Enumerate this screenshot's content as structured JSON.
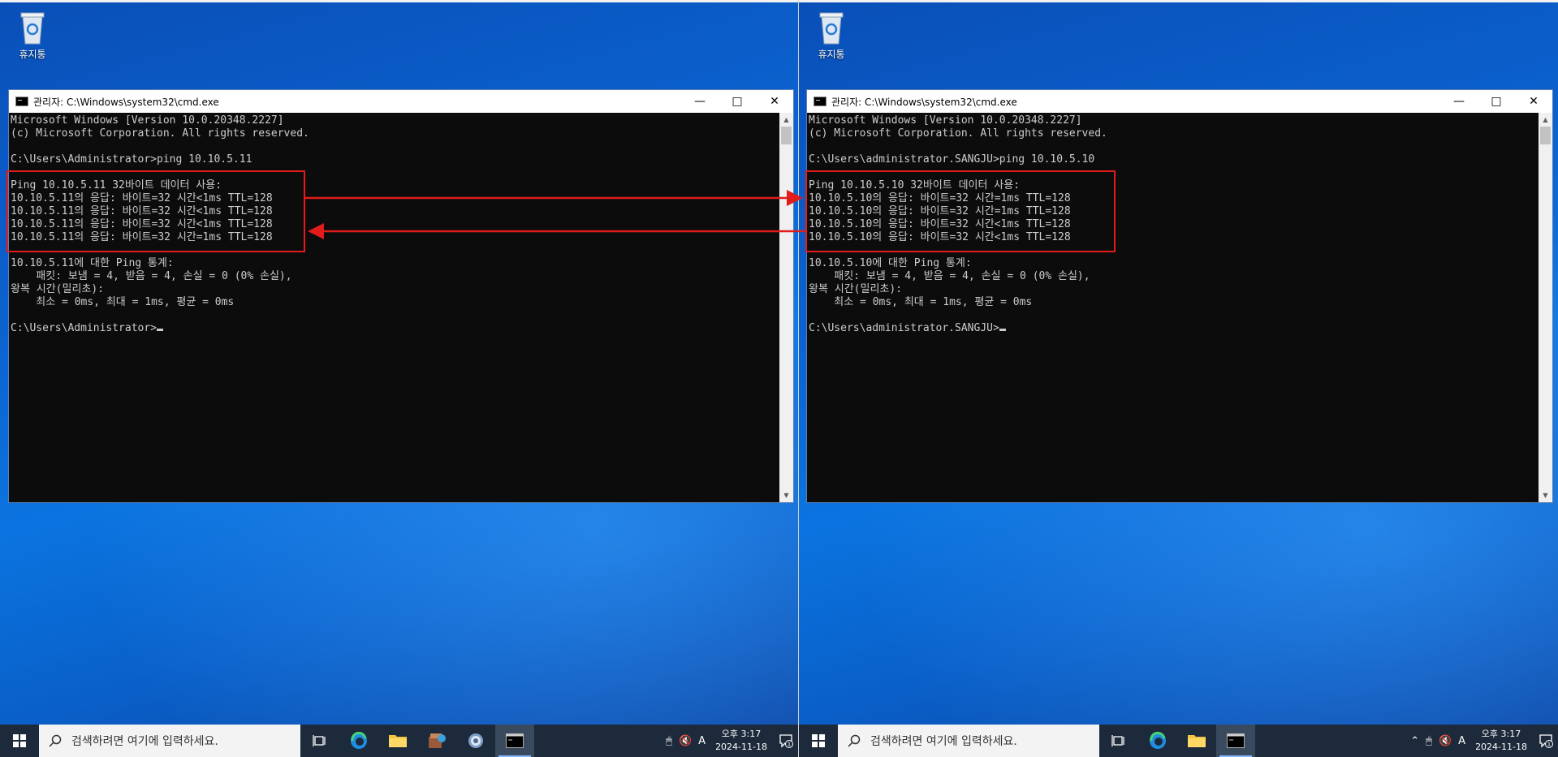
{
  "desktop": {
    "recycle_label": "휴지통"
  },
  "left": {
    "window_title": "관리자: C:\\Windows\\system32\\cmd.exe",
    "lines": [
      "Microsoft Windows [Version 10.0.20348.2227]",
      "(c) Microsoft Corporation. All rights reserved.",
      "",
      "C:\\Users\\Administrator>ping 10.10.5.11",
      "",
      "Ping 10.10.5.11 32바이트 데이터 사용:",
      "10.10.5.11의 응답: 바이트=32 시간<1ms TTL=128",
      "10.10.5.11의 응답: 바이트=32 시간<1ms TTL=128",
      "10.10.5.11의 응답: 바이트=32 시간<1ms TTL=128",
      "10.10.5.11의 응답: 바이트=32 시간=1ms TTL=128",
      "",
      "10.10.5.11에 대한 Ping 통계:",
      "    패킷: 보냄 = 4, 받음 = 4, 손실 = 0 (0% 손실),",
      "왕복 시간(밀리초):",
      "    최소 = 0ms, 최대 = 1ms, 평균 = 0ms",
      "",
      "C:\\Users\\Administrator>"
    ],
    "search_placeholder": "검색하려면 여기에 입력하세요.",
    "clock_time": "오후 3:17",
    "clock_date": "2024-11-18",
    "input_indicator": "A",
    "notification_count": "1"
  },
  "right": {
    "window_title": "관리자: C:\\Windows\\system32\\cmd.exe",
    "lines": [
      "Microsoft Windows [Version 10.0.20348.2227]",
      "(c) Microsoft Corporation. All rights reserved.",
      "",
      "C:\\Users\\administrator.SANGJU>ping 10.10.5.10",
      "",
      "Ping 10.10.5.10 32바이트 데이터 사용:",
      "10.10.5.10의 응답: 바이트=32 시간=1ms TTL=128",
      "10.10.5.10의 응답: 바이트=32 시간=1ms TTL=128",
      "10.10.5.10의 응답: 바이트=32 시간<1ms TTL=128",
      "10.10.5.10의 응답: 바이트=32 시간<1ms TTL=128",
      "",
      "10.10.5.10에 대한 Ping 통계:",
      "    패킷: 보냄 = 4, 받음 = 4, 손실 = 0 (0% 손실),",
      "왕복 시간(밀리초):",
      "    최소 = 0ms, 최대 = 1ms, 평균 = 0ms",
      "",
      "C:\\Users\\administrator.SANGJU>"
    ],
    "search_placeholder": "검색하려면 여기에 입력하세요.",
    "clock_time": "오후 3:17",
    "clock_date": "2024-11-18",
    "input_indicator": "A",
    "notification_count": "1"
  },
  "colors": {
    "annotation": "#e21b1b",
    "console_text": "#cccccc",
    "console_bg": "#0c0c0c",
    "taskbar": "#1c2a3b"
  }
}
